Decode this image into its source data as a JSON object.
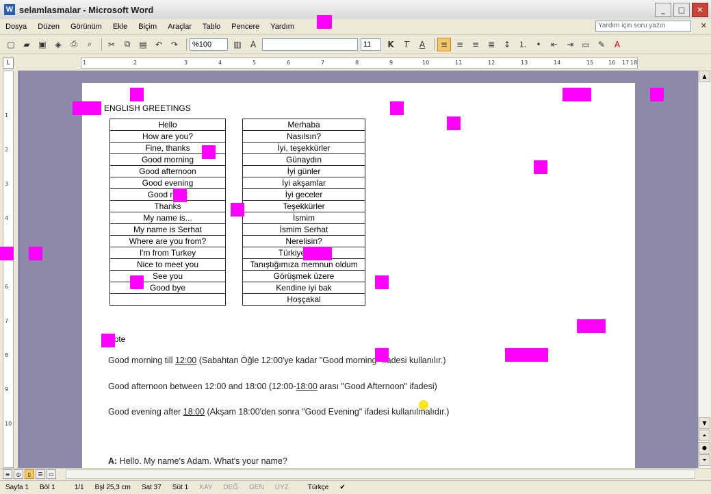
{
  "window": {
    "title": "selamlasmalar - Microsoft Word",
    "icon": "word-icon",
    "controls": [
      "_",
      "□",
      "✕"
    ]
  },
  "menu": {
    "items": [
      "Dosya",
      "Düzen",
      "Görünüm",
      "Ekle",
      "Biçim",
      "Araçlar",
      "Tablo",
      "Pencere",
      "Yardım"
    ],
    "help_placeholder": "Yardım için soru yazın"
  },
  "toolbar": {
    "zoom": "%100",
    "font_size": "11",
    "bold": "K",
    "italic": "T",
    "underline": "A"
  },
  "ruler": {
    "ticks": [
      "1",
      "2",
      "3",
      "4",
      "5",
      "6",
      "7",
      "8",
      "9",
      "10",
      "11",
      "12",
      "13",
      "14",
      "15",
      "16",
      "17",
      "18"
    ]
  },
  "document": {
    "heading": "ENGLISH GREETINGS",
    "table": [
      {
        "en": "Hello",
        "tr": "Merhaba"
      },
      {
        "en": "How are you?",
        "tr": "Nasılsın?"
      },
      {
        "en": "Fine, thanks",
        "tr": "İyi, teşekkürler"
      },
      {
        "en": "Good morning",
        "tr": "Günaydın"
      },
      {
        "en": "Good afternoon",
        "tr": "İyi günler"
      },
      {
        "en": "Good evening",
        "tr": "İyi akşamlar"
      },
      {
        "en": "Good night",
        "tr": "İyi geceler"
      },
      {
        "en": "Thanks",
        "tr": "Teşekkürler"
      },
      {
        "en": "My name is...",
        "tr": "İsmim"
      },
      {
        "en": "My name is Serhat",
        "tr": "İsmim Serhat"
      },
      {
        "en": "Where are you from?",
        "tr": "Nerelisin?"
      },
      {
        "en": "I'm from Turkey",
        "tr": "Türkiye'denim"
      },
      {
        "en": "Nice to meet you",
        "tr": "Tanıştığımıza memnun oldum"
      },
      {
        "en": "See you",
        "tr": "Görüşmek üzere"
      },
      {
        "en": "Good bye",
        "tr": "Kendine iyi bak"
      },
      {
        "en": "",
        "tr": "Hoşçakal"
      }
    ],
    "note": "Note",
    "para1": {
      "pre": "Good morning till ",
      "time": "12:00",
      "post": " (Sabahtan Öğle 12:00'ye kadar \"Good morning\" ifadesi kullanılır.)"
    },
    "para2": {
      "pre": "Good afternoon between 12:00 and 18:00 (12:00-",
      "time": "18:00",
      "post": " arası \"Good Afternoon\" ifadesi)"
    },
    "para3": {
      "pre": "Good evening after ",
      "time": "18:00",
      "post": " (Akşam 18:00'den sonra \"Good Evening\" ifadesi kullanılmalıdır.)"
    },
    "dialog_speaker": "A:",
    "dialog_text": " Hello. My name's Adam. What's your name?"
  },
  "status": {
    "page": "Sayfa 1",
    "section": "Böl 1",
    "pages": "1/1",
    "position": "Bşl 25,3 cm",
    "line": "Sat 37",
    "column": "Süt 1",
    "rec": "KAY",
    "trk": "DEĞ",
    "ext": "GEN",
    "ovr": "ÜYZ",
    "language": "Türkçe"
  },
  "colors": {
    "artifact": "#ff00ff",
    "page_bg": "#8c8aa8",
    "active_button": "#f2c66a"
  }
}
